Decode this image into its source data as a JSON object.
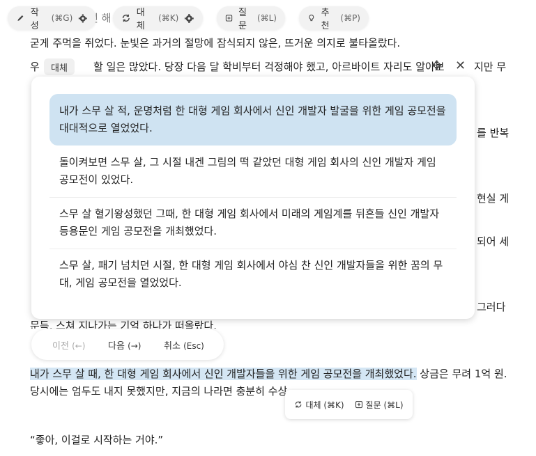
{
  "toolbar": {
    "write": {
      "label": "작성",
      "shortcut": "(⌘G)"
    },
    "replace": {
      "label": "대체",
      "shortcut": "(⌘K)"
    },
    "question": {
      "label": "질문",
      "shortcut": "(⌘L)"
    },
    "recommend": {
      "label": "추천",
      "shortcut": "(⌘P)"
    },
    "behind_text": "던 해"
  },
  "document": {
    "lines": [
      "굳게 주먹을 쥐었다. 눈빛은 과거의 절망에 잠식되지 않은, 뜨거운 의지로 불타올랐다.",
      "우",
      "할 일은 많았다. 당장 다음 달 학비부터 걱정해야 했고, 아르바이트 자리도 알아보",
      "지만 무"
    ],
    "right_frags": [
      "를 반복",
      "현실 게",
      "되어 세",
      "그러다"
    ],
    "line_partial": "문득, 스쳐 지나가는 기억 하나가 떠올랐다.",
    "highlight": "내가 스무 살 때, 한 대형 게임 회사에서 신인 개발자들을 위한 게임 공모전을 개최했었다.",
    "highlight_after": " 상금은 무려 1억 원.",
    "line_next": "당시에는 엄두도 내지 못했지만, 지금의 나라면 충분히 수상",
    "quote": "“좋아, 이걸로 시작하는 거야.”"
  },
  "replace_panel": {
    "tag": "대체",
    "move_icon": "✥",
    "close_icon": "✕",
    "options": [
      "내가 스무 살 적, 운명처럼 한 대형 게임 회사에서 신인 개발자 발굴을 위한 게임 공모전을 대대적으로 열었었다.",
      "돌이켜보면 스무 살, 그 시절 내겐 그림의 떡 같았던 대형 게임 회사의 신인 개발자 게임 공모전이 있었다.",
      "스무 살 혈기왕성했던 그때, 한 대형 게임 회사에서 미래의 게임계를 뒤흔들 신인 개발자 등용문인 게임 공모전을 개최했었다.",
      "스무 살, 패기 넘치던 시절, 한 대형 게임 회사에서 야심 찬 신인 개발자들을 위한 꿈의 무대, 게임 공모전을 열었었다."
    ],
    "selected_index": 0
  },
  "nav": {
    "prev": {
      "label": "이전",
      "shortcut": "(←)"
    },
    "next": {
      "label": "다음",
      "shortcut": "(→)"
    },
    "cancel": {
      "label": "취소",
      "shortcut": "(Esc)"
    }
  },
  "mini_toolbar": {
    "replace": {
      "label": "대체",
      "shortcut": "(⌘K)"
    },
    "question": {
      "label": "질문",
      "shortcut": "(⌘L)"
    }
  }
}
